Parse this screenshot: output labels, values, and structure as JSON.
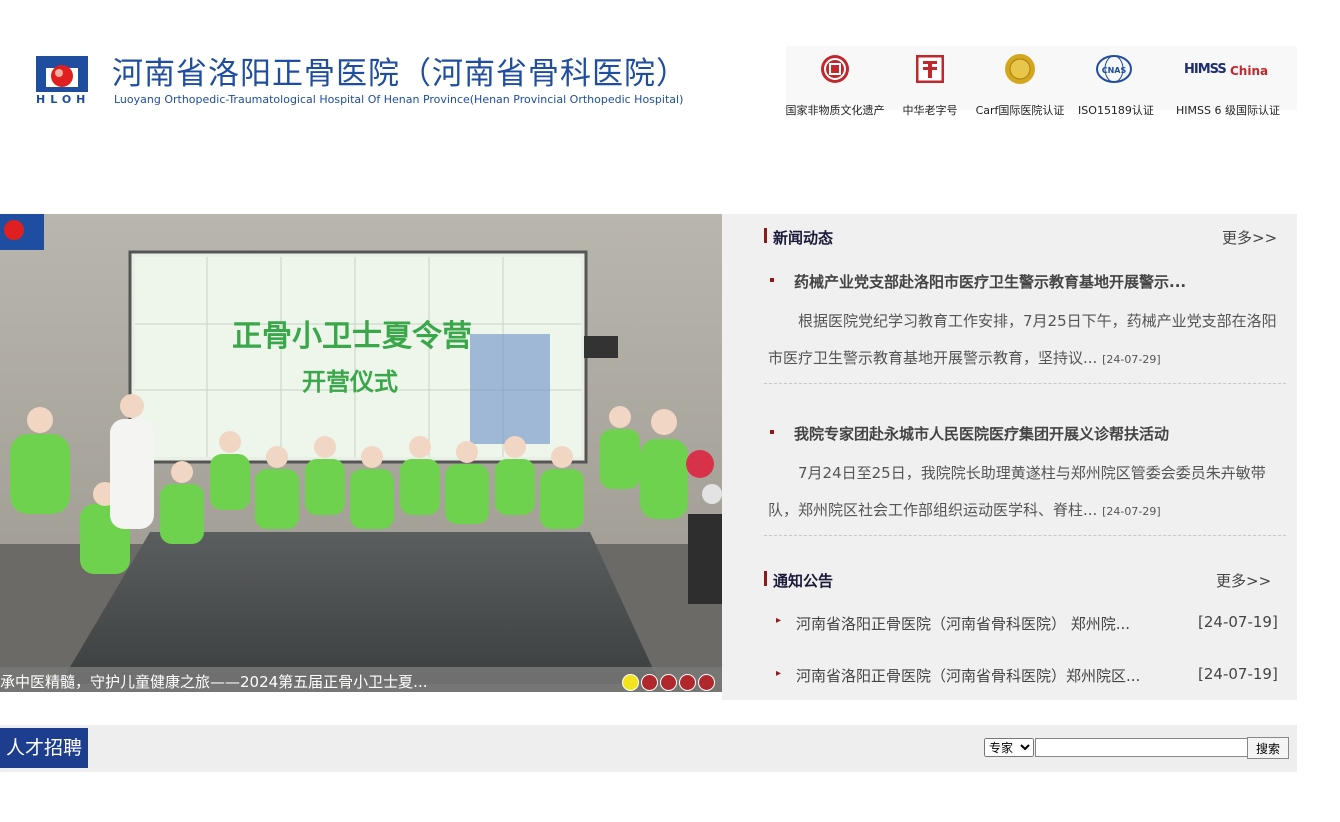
{
  "header": {
    "title_cn": "河南省洛阳正骨医院（河南省骨科医院）",
    "title_en": "Luoyang Orthopedic-Traumatological Hospital Of Henan Province(Henan Provincial Orthopedic Hospital)",
    "logo_letters": "HLOH",
    "certs": [
      {
        "label": "国家非物质文化遗产",
        "icon": "intangible-heritage-icon"
      },
      {
        "label": "中华老字号",
        "icon": "time-honored-brand-icon"
      },
      {
        "label": "Carf国际医院认证",
        "icon": "carf-seal-icon"
      },
      {
        "label": "ISO15189认证",
        "icon": "cnas-icon"
      },
      {
        "label": "HIMSS 6 级国际认证",
        "icon": "himss-logo-icon"
      }
    ],
    "himss_text": "HIMSS",
    "himss_sub": "China",
    "cnas_text": "CNAS"
  },
  "slider": {
    "caption": "承中医精髓，守护儿童健康之旅——2024第五届正骨小卫士夏...",
    "screen_text": "正骨小卫士夏令营",
    "screen_sub": "开营仪式",
    "active_dot": 0,
    "dot_count": 5
  },
  "news": {
    "heading": "新闻动态",
    "more": "更多>>",
    "items": [
      {
        "title": "药械产业党支部赴洛阳市医疗卫生警示教育基地开展警示...",
        "body": "根据医院党纪学习教育工作安排，7月25日下午，药械产业党支部在洛阳市医疗卫生警示教育基地开展警示教育，坚持议...",
        "date": "[24-07-29]"
      },
      {
        "title": "我院专家团赴永城市人民医院医疗集团开展义诊帮扶活动",
        "body": "7月24日至25日，我院院长助理黄遂柱与郑州院区管委会委员朱卉敏带队，郑州院区社会工作部组织运动医学科、脊柱...",
        "date": "[24-07-29]"
      }
    ]
  },
  "notice": {
    "heading": "通知公告",
    "more": "更多>>",
    "items": [
      {
        "text": "河南省洛阳正骨医院（河南省骨科医院） 郑州院...",
        "date": "[24-07-19]"
      },
      {
        "text": "河南省洛阳正骨医院（河南省骨科医院）郑州院区...",
        "date": "[24-07-19]"
      }
    ]
  },
  "bottom": {
    "recruit_label": "人才招聘",
    "search_select_value": "专家",
    "search_value": "",
    "search_button": "搜索"
  },
  "colors": {
    "brand_blue": "#1f4ea0",
    "recruit_blue": "#1d3d8e",
    "accent_red": "#8b1a1a",
    "dot_red": "#b0282c",
    "dot_active": "#f2e31c"
  }
}
